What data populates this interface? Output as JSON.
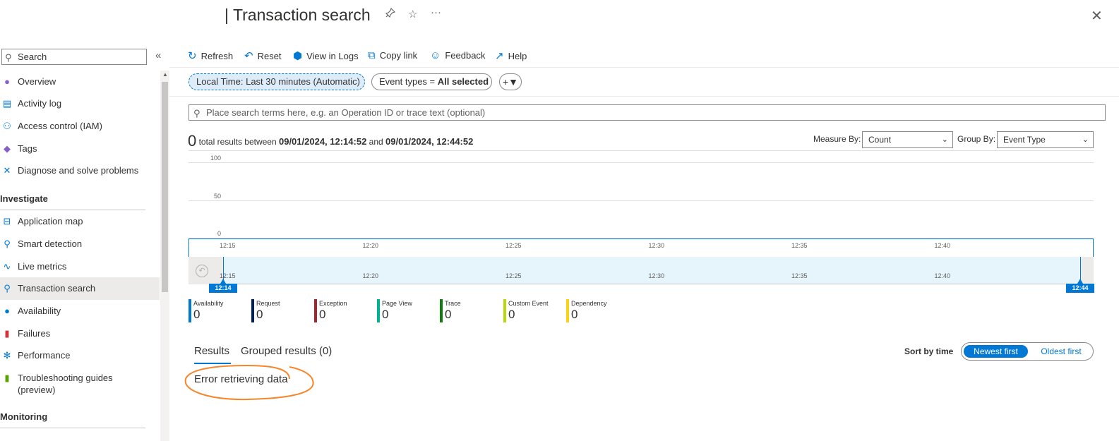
{
  "header": {
    "title": "| Transaction search",
    "pin_icon": "pin-icon",
    "star_icon": "star-icon",
    "more_label": "···",
    "close_label": "✕"
  },
  "sidebar": {
    "search_placeholder": "Search",
    "collapse_label": "«",
    "top_items": [
      {
        "label": "Overview",
        "icon": "overview-icon"
      },
      {
        "label": "Activity log",
        "icon": "activity-log-icon"
      },
      {
        "label": "Access control (IAM)",
        "icon": "access-control-icon"
      },
      {
        "label": "Tags",
        "icon": "tag-icon"
      },
      {
        "label": "Diagnose and solve problems",
        "icon": "wrench-icon"
      }
    ],
    "investigate": {
      "heading": "Investigate",
      "items": [
        {
          "label": "Application map",
          "icon": "application-map-icon"
        },
        {
          "label": "Smart detection",
          "icon": "smart-detection-icon"
        },
        {
          "label": "Live metrics",
          "icon": "live-metrics-icon"
        },
        {
          "label": "Transaction search",
          "icon": "search-icon",
          "active": true
        },
        {
          "label": "Availability",
          "icon": "globe-icon"
        },
        {
          "label": "Failures",
          "icon": "failures-icon"
        },
        {
          "label": "Performance",
          "icon": "performance-icon"
        },
        {
          "label": "Troubleshooting guides",
          "label2": "(preview)",
          "icon": "book-icon"
        }
      ]
    },
    "monitoring_heading": "Monitoring"
  },
  "toolbar": {
    "refresh": "Refresh",
    "reset": "Reset",
    "view_in_logs": "View in Logs",
    "copy_link": "Copy link",
    "feedback": "Feedback",
    "help": "Help"
  },
  "filters": {
    "time": "Local Time: Last 30 minutes (Automatic)",
    "event_types_prefix": "Event types = ",
    "event_types_value": "All selected",
    "add_filter_icon": "add-filter-icon"
  },
  "search": {
    "placeholder": "Place search terms here, e.g. an Operation ID or trace text (optional)"
  },
  "summary": {
    "count": "0",
    "text1": " total results between ",
    "start": "09/01/2024, 12:14:52",
    "and": " and ",
    "end": "09/01/2024, 12:44:52"
  },
  "measure": {
    "label": "Measure By:",
    "value": "Count"
  },
  "group": {
    "label": "Group By:",
    "value": "Event Type"
  },
  "chart_data": {
    "type": "bar",
    "y_ticks": [
      "100",
      "50",
      "0"
    ],
    "ylim": [
      0,
      100
    ],
    "x_ticks": [
      "12:15",
      "12:20",
      "12:25",
      "12:30",
      "12:35",
      "12:40"
    ],
    "brush_start": "12:14",
    "brush_end": "12:44",
    "series": []
  },
  "legend": [
    {
      "name": "Availability",
      "value": "0",
      "color": "#0078d4"
    },
    {
      "name": "Request",
      "value": "0",
      "color": "#002050"
    },
    {
      "name": "Exception",
      "value": "0",
      "color": "#a4262c"
    },
    {
      "name": "Page View",
      "value": "0",
      "color": "#00b294"
    },
    {
      "name": "Trace",
      "value": "0",
      "color": "#107c10"
    },
    {
      "name": "Custom Event",
      "value": "0",
      "color": "#bad80a"
    },
    {
      "name": "Dependency",
      "value": "0",
      "color": "#fcd116"
    }
  ],
  "results": {
    "tab_results": "Results",
    "tab_grouped": "Grouped results (0)",
    "sort_label": "Sort by time",
    "newest": "Newest first",
    "oldest": "Oldest first",
    "error": "Error retrieving data"
  },
  "colors": {
    "accent": "#0078d4",
    "annotation": "#f7862a"
  }
}
